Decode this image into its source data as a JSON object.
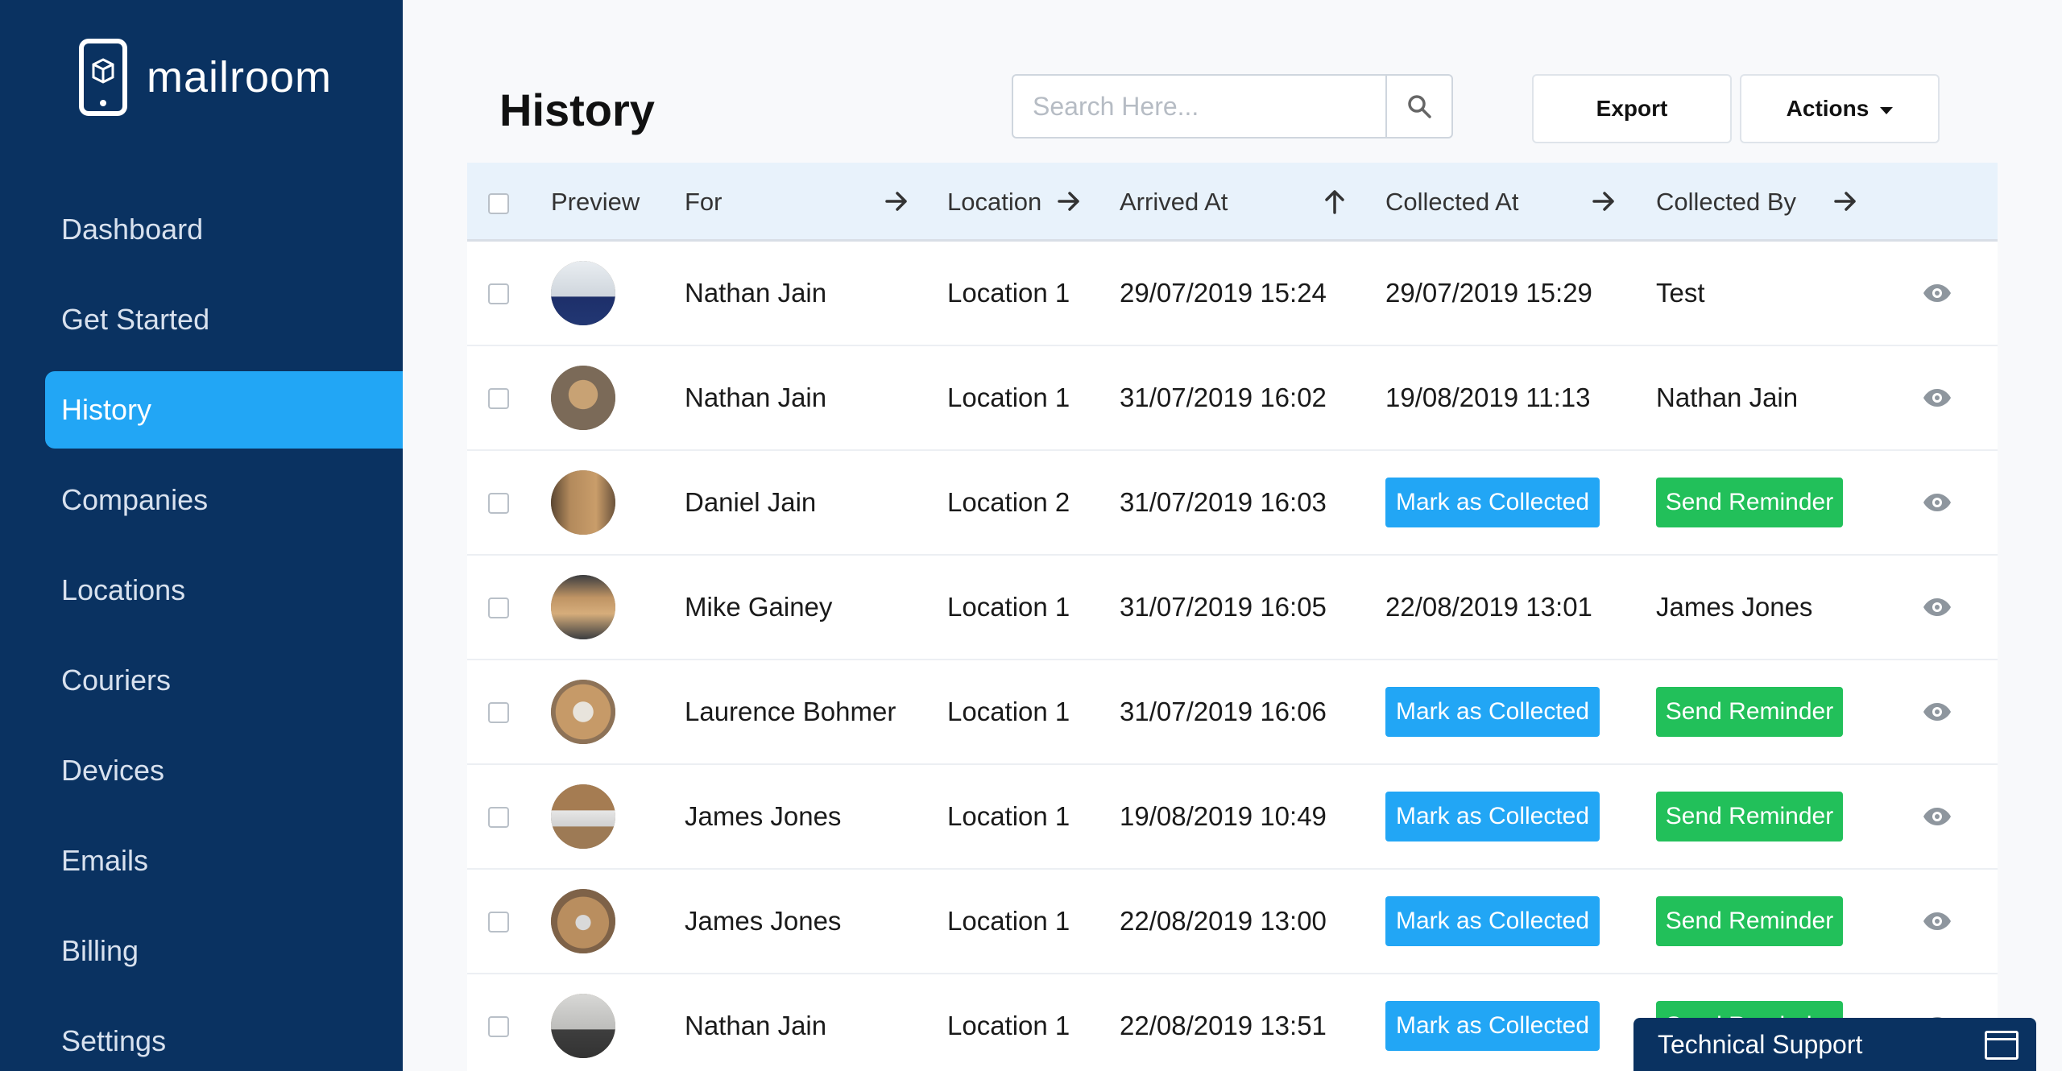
{
  "brand": {
    "name": "mailroom"
  },
  "sidebar": {
    "items": [
      {
        "label": "Dashboard",
        "active": false
      },
      {
        "label": "Get Started",
        "active": false
      },
      {
        "label": "History",
        "active": true
      },
      {
        "label": "Companies",
        "active": false
      },
      {
        "label": "Locations",
        "active": false
      },
      {
        "label": "Couriers",
        "active": false
      },
      {
        "label": "Devices",
        "active": false
      },
      {
        "label": "Emails",
        "active": false
      },
      {
        "label": "Billing",
        "active": false
      },
      {
        "label": "Settings",
        "active": false
      }
    ]
  },
  "header": {
    "title": "History",
    "search_placeholder": "Search Here...",
    "export_label": "Export",
    "actions_label": "Actions"
  },
  "table": {
    "columns": {
      "preview": "Preview",
      "for": "For",
      "location": "Location",
      "arrived_at": "Arrived At",
      "collected_at": "Collected At",
      "collected_by": "Collected By"
    },
    "mark_label": "Mark as Collected",
    "reminder_label": "Send Reminder",
    "rows": [
      {
        "for": "Nathan Jain",
        "location": "Location 1",
        "arrived_at": "29/07/2019 15:24",
        "collected_at": "29/07/2019 15:29",
        "collected_by": "Test"
      },
      {
        "for": "Nathan Jain",
        "location": "Location 1",
        "arrived_at": "31/07/2019 16:02",
        "collected_at": "19/08/2019 11:13",
        "collected_by": "Nathan Jain"
      },
      {
        "for": "Daniel Jain",
        "location": "Location 2",
        "arrived_at": "31/07/2019 16:03",
        "collected_at": "",
        "collected_by": ""
      },
      {
        "for": "Mike Gainey",
        "location": "Location 1",
        "arrived_at": "31/07/2019 16:05",
        "collected_at": "22/08/2019 13:01",
        "collected_by": "James Jones"
      },
      {
        "for": "Laurence Bohmer",
        "location": "Location 1",
        "arrived_at": "31/07/2019 16:06",
        "collected_at": "",
        "collected_by": ""
      },
      {
        "for": "James Jones",
        "location": "Location 1",
        "arrived_at": "19/08/2019 10:49",
        "collected_at": "",
        "collected_by": ""
      },
      {
        "for": "James Jones",
        "location": "Location 1",
        "arrived_at": "22/08/2019 13:00",
        "collected_at": "",
        "collected_by": ""
      },
      {
        "for": "Nathan Jain",
        "location": "Location 1",
        "arrived_at": "22/08/2019 13:51",
        "collected_at": "",
        "collected_by": ""
      }
    ]
  },
  "support": {
    "label": "Technical Support"
  },
  "colors": {
    "sidebar": "#0a3261",
    "accent": "#22a6f5",
    "success": "#22c05a"
  }
}
